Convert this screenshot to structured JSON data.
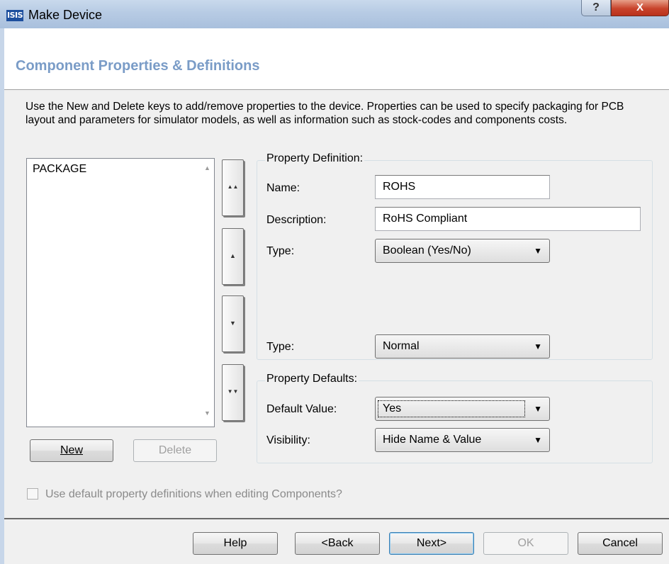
{
  "window": {
    "title": "Make Device",
    "logo_text": "ISIS",
    "help_button": "?",
    "close_button": "X"
  },
  "header": {
    "title": "Component Properties & Definitions"
  },
  "description": "Use the New and Delete keys to add/remove properties to the device. Properties can be used to specify packaging for PCB layout and parameters for simulator models, as well as information such as stock-codes and components costs.",
  "properties_list": {
    "items": [
      "PACKAGE"
    ]
  },
  "list_buttons": {
    "new": "New",
    "delete": "Delete"
  },
  "move_buttons": {
    "top": "▲▲",
    "up": "▲",
    "down": "▼",
    "bottom": "▼▼"
  },
  "property_definition": {
    "group_label": "Property Definition:",
    "name_label": "Name:",
    "name_value": "ROHS",
    "description_label": "Description:",
    "description_value": "RoHS Compliant",
    "type_label": "Type:",
    "type_value": "Boolean (Yes/No)",
    "type2_label": "Type:",
    "type2_value": "Normal"
  },
  "property_defaults": {
    "group_label": "Property Defaults:",
    "default_value_label": "Default Value:",
    "default_value": "Yes",
    "visibility_label": "Visibility:",
    "visibility_value": "Hide Name & Value"
  },
  "option": {
    "use_default_definitions": "Use default property definitions when editing Components?",
    "checked": false
  },
  "footer": {
    "help": "Help",
    "back": "<Back",
    "next": "Next>",
    "ok": "OK",
    "cancel": "Cancel"
  },
  "colors": {
    "heading": "#7a9cc7",
    "title_bar": "#b7cbe4",
    "close_button": "#c8432b"
  }
}
